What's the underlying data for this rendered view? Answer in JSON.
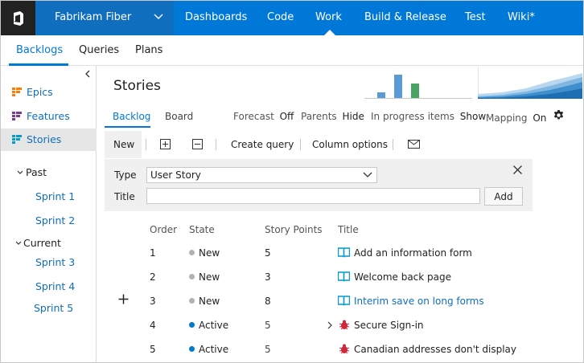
{
  "topbar": {
    "project": "Fabrikam Fiber",
    "nav": [
      {
        "label": "Dashboards"
      },
      {
        "label": "Code"
      },
      {
        "label": "Work",
        "active": true
      },
      {
        "label": "Build & Release"
      },
      {
        "label": "Test"
      },
      {
        "label": "Wiki*"
      }
    ]
  },
  "subnav": {
    "items": [
      {
        "label": "Backlogs",
        "active": true
      },
      {
        "label": "Queries"
      },
      {
        "label": "Plans"
      }
    ]
  },
  "leftpane": {
    "levels": [
      {
        "label": "Epics",
        "icon": "epic-icon",
        "color": "#ff7b00"
      },
      {
        "label": "Features",
        "icon": "feature-icon",
        "color": "#773b93"
      },
      {
        "label": "Stories",
        "icon": "story-icon",
        "color": "#009ccc",
        "selected": true
      }
    ],
    "past": {
      "label": "Past",
      "sprints": [
        "Sprint 1",
        "Sprint 2"
      ]
    },
    "current": {
      "label": "Current",
      "sprints": [
        "Sprint 3",
        "Sprint 4",
        "Sprint 5"
      ]
    }
  },
  "page": {
    "title": "Stories",
    "pivots": [
      {
        "label": "Backlog",
        "active": true
      },
      {
        "label": "Board"
      }
    ],
    "options": {
      "forecast": {
        "label": "Forecast",
        "value": "Off"
      },
      "parents": {
        "label": "Parents",
        "value": "Hide"
      },
      "in_progress": {
        "label": "In progress items",
        "value": "Show"
      },
      "mapping": {
        "label": "Mapping",
        "value": "On"
      }
    }
  },
  "toolbar": {
    "new_label": "New",
    "create_query": "Create query",
    "column_options": "Column options"
  },
  "add_panel": {
    "type_label": "Type",
    "type_value": "User Story",
    "title_label": "Title",
    "title_value": "",
    "add_button": "Add"
  },
  "grid": {
    "headers": {
      "order": "Order",
      "state": "State",
      "points": "Story Points",
      "title": "Title"
    },
    "rows": [
      {
        "order": "1",
        "state": "New",
        "state_color": "#b2b2b2",
        "points": "5",
        "title": "Add an information form",
        "type": "story"
      },
      {
        "order": "2",
        "state": "New",
        "state_color": "#b2b2b2",
        "points": "3",
        "title": "Welcome back page",
        "type": "story"
      },
      {
        "order": "3",
        "state": "New",
        "state_color": "#b2b2b2",
        "points": "8",
        "title": "Interim save on long forms",
        "type": "story",
        "link": true
      },
      {
        "order": "4",
        "state": "Active",
        "state_color": "#007acc",
        "points": "5",
        "title": "Secure Sign-in",
        "type": "bug",
        "expandable": true
      },
      {
        "order": "5",
        "state": "Active",
        "state_color": "#007acc",
        "points": "5",
        "title": "Canadian addresses don't display",
        "type": "bug"
      }
    ]
  },
  "colors": {
    "brand": "#0078d7",
    "link": "#106ebe",
    "bug": "#cc293d",
    "story": "#009ccc"
  }
}
